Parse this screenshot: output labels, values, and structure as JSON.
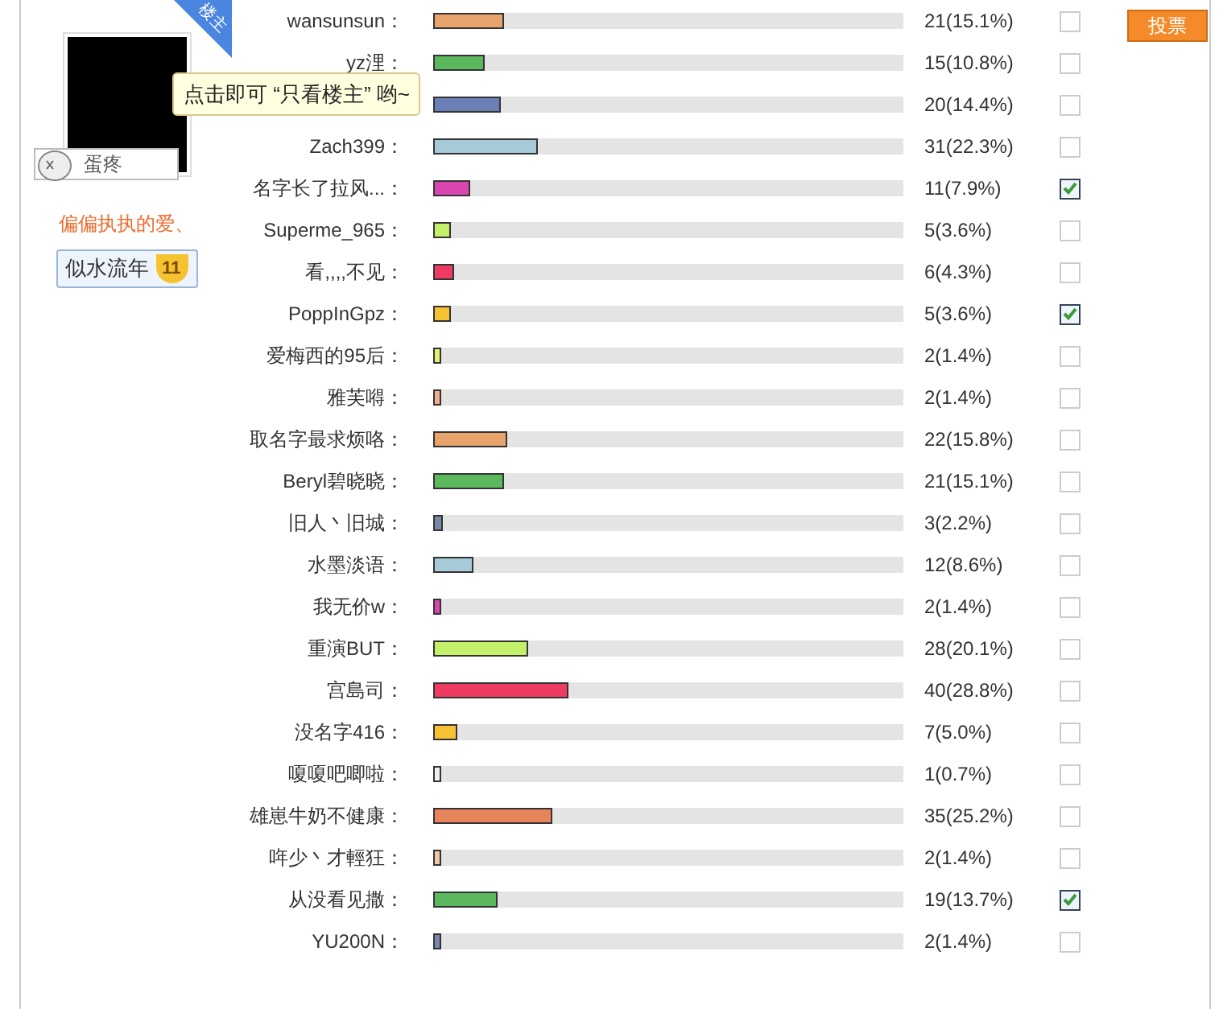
{
  "author": {
    "corner_tag": "楼主",
    "badge": "蛋疼",
    "name": "偏偏执执的爱、",
    "group": {
      "label": "似水流年",
      "level": "11"
    }
  },
  "tooltip": "点击即可 “只看楼主” 哟~",
  "vote_button": "投票",
  "options": [
    {
      "name": "wansunsun：",
      "reading": "21(15.1%)",
      "level": 0.151,
      "color": "#e8a46c",
      "checked": false
    },
    {
      "name": "yz浬：",
      "reading": "15(10.8%)",
      "level": 0.108,
      "color": "#5cb85c",
      "checked": false
    },
    {
      "reading": "20(14.4%)",
      "level": 0.144,
      "color": "#6a7fb5",
      "checked": false
    },
    {
      "name": "Zach399：",
      "reading": "31(22.3%)",
      "level": 0.223,
      "color": "#a6cad8",
      "checked": false
    },
    {
      "name": "名字长了拉风...：",
      "reading": "11(7.9%)",
      "level": 0.079,
      "color": "#d946b0",
      "checked": true
    },
    {
      "name": "Superme_965：",
      "reading": "5(3.6%)",
      "level": 0.036,
      "color": "#c4ef6a",
      "checked": false
    },
    {
      "name": "看,,,,不见：",
      "reading": "6(4.3%)",
      "level": 0.043,
      "color": "#ef3a62",
      "checked": false
    },
    {
      "name": "PoppInGpz：",
      "reading": "5(3.6%)",
      "level": 0.036,
      "color": "#f6c232",
      "checked": true
    },
    {
      "name": "爱梅西的95后：",
      "reading": "2(1.4%)",
      "level": 0.014,
      "color": "#e6f070",
      "checked": false
    },
    {
      "name": "雅芙嘚：",
      "reading": "2(1.4%)",
      "level": 0.014,
      "color": "#f0b090",
      "checked": false
    },
    {
      "name": "取名字最求烦咯：",
      "reading": "22(15.8%)",
      "level": 0.158,
      "color": "#e8a46c",
      "checked": false
    },
    {
      "name": "Beryl碧晓晓：",
      "reading": "21(15.1%)",
      "level": 0.151,
      "color": "#5cb85c",
      "checked": false
    },
    {
      "name": "旧人丶旧城：",
      "reading": "3(2.2%)",
      "level": 0.022,
      "color": "#7a88a8",
      "checked": false
    },
    {
      "name": "水墨淡语：",
      "reading": "12(8.6%)",
      "level": 0.086,
      "color": "#a6cad8",
      "checked": false
    },
    {
      "name": "我无价w：",
      "reading": "2(1.4%)",
      "level": 0.014,
      "color": "#d946b0",
      "checked": false
    },
    {
      "name": "重演BUT：",
      "reading": "28(20.1%)",
      "level": 0.201,
      "color": "#c4ef6a",
      "checked": false
    },
    {
      "name": "宫島司：",
      "reading": "40(28.8%)",
      "level": 0.288,
      "color": "#ef3a62",
      "checked": false
    },
    {
      "name": "没名字416：",
      "reading": "7(5.0%)",
      "level": 0.05,
      "color": "#f6c232",
      "checked": false
    },
    {
      "name": "嗄嗄吧唧啦：",
      "reading": "1(0.7%)",
      "level": 0.007,
      "color": "#f0f0f0",
      "checked": false
    },
    {
      "name": "雄崽牛奶不健康：",
      "reading": "35(25.2%)",
      "level": 0.252,
      "color": "#e8845c",
      "checked": false
    },
    {
      "name": "哖少丶才輕狂：",
      "reading": "2(1.4%)",
      "level": 0.014,
      "color": "#f0c8a8",
      "checked": false
    },
    {
      "name": "从没看见撒：",
      "reading": "19(13.7%)",
      "level": 0.137,
      "color": "#5cb85c",
      "checked": true
    },
    {
      "name": "YU200N：",
      "reading": "2(1.4%)",
      "level": 0.014,
      "color": "#7a88b0",
      "checked": false
    }
  ]
}
